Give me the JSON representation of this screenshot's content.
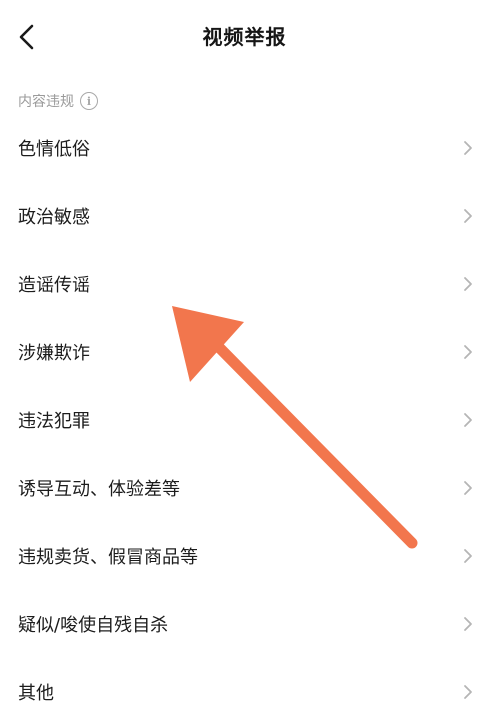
{
  "header": {
    "title": "视频举报",
    "back_icon": "chevron-left-icon"
  },
  "section": {
    "label": "内容违规",
    "info_icon": "info-icon",
    "info_glyph": "i"
  },
  "items": [
    {
      "label": "色情低俗"
    },
    {
      "label": "政治敏感"
    },
    {
      "label": "造谣传谣"
    },
    {
      "label": "涉嫌欺诈"
    },
    {
      "label": "违法犯罪"
    },
    {
      "label": "诱导互动、体验差等"
    },
    {
      "label": "违规卖货、假冒商品等"
    },
    {
      "label": "疑似/唆使自残自杀"
    },
    {
      "label": "其他"
    }
  ],
  "annotation": {
    "arrow_color": "#f2764d",
    "points_to": "造谣传谣"
  },
  "colors": {
    "text": "#1c1c1c",
    "muted": "#9a9a9a",
    "chevron": "#b5b5b5"
  }
}
